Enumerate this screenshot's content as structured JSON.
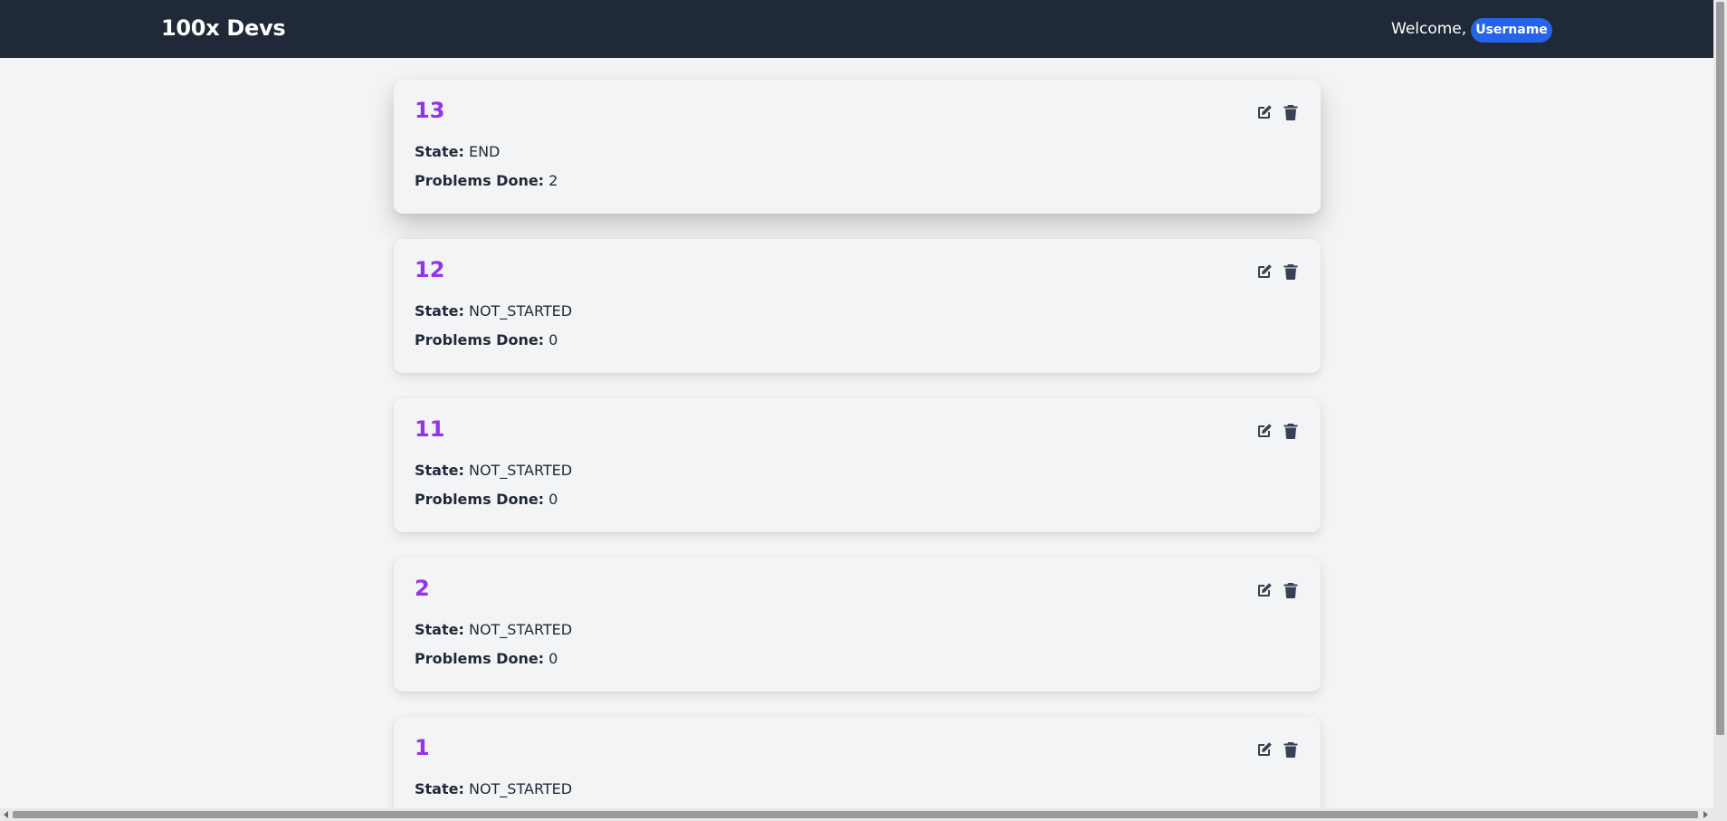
{
  "app": {
    "brand": "100x Devs",
    "welcome_text": "Welcome,",
    "username": "Username"
  },
  "labels": {
    "state": "State:",
    "problems_done": "Problems Done:"
  },
  "contests": [
    {
      "id": "13",
      "state": "END",
      "problems_done": "2"
    },
    {
      "id": "12",
      "state": "NOT_STARTED",
      "problems_done": "0"
    },
    {
      "id": "11",
      "state": "NOT_STARTED",
      "problems_done": "0"
    },
    {
      "id": "2",
      "state": "NOT_STARTED",
      "problems_done": "0"
    },
    {
      "id": "1",
      "state": "NOT_STARTED",
      "problems_done": ""
    }
  ],
  "icons": {
    "edit": "edit-icon",
    "delete": "trash-icon"
  },
  "colors": {
    "navbar": "#1f2937",
    "accent_purple": "#9333ea",
    "pill_blue": "#2563eb",
    "background": "#f3f4f6"
  }
}
